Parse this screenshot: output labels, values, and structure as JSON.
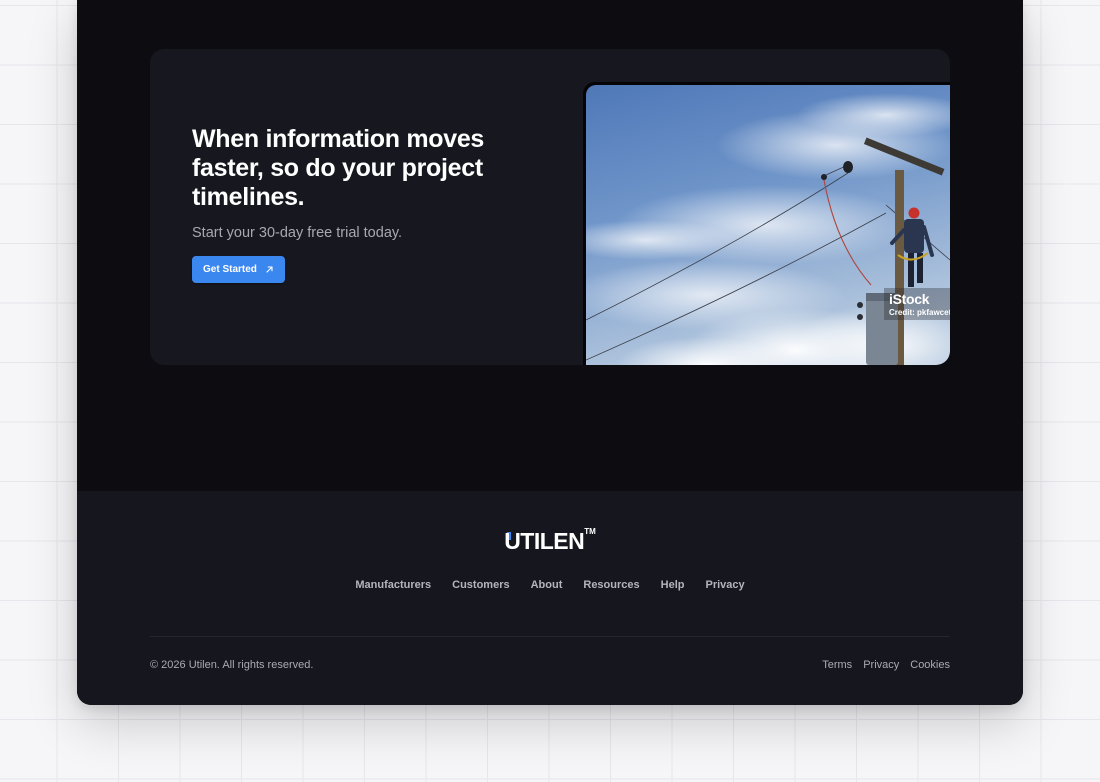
{
  "cta": {
    "heading": "When information moves faster, so do your project timelines.",
    "subheading": "Start your 30-day free trial today.",
    "button_label": "Get Started",
    "button_icon": "arrow-up-right-icon",
    "image": {
      "subject": "utility lineworker on power pole",
      "watermark_logo": "iStock",
      "watermark_credit": "Credit: pkfawcett"
    }
  },
  "footer": {
    "brand": {
      "name": "UTILEN",
      "trademark": "TM"
    },
    "nav": [
      "Manufacturers",
      "Customers",
      "About",
      "Resources",
      "Help",
      "Privacy"
    ],
    "copyright": "© 2026 Utilen. All rights reserved.",
    "legal": [
      "Terms",
      "Privacy",
      "Cookies"
    ]
  },
  "colors": {
    "page_background": "#0c0c11",
    "card_background": "#17181f",
    "footer_background": "#16171e",
    "accent": "#3b87f0",
    "outer_background": "#f6f6f9"
  }
}
